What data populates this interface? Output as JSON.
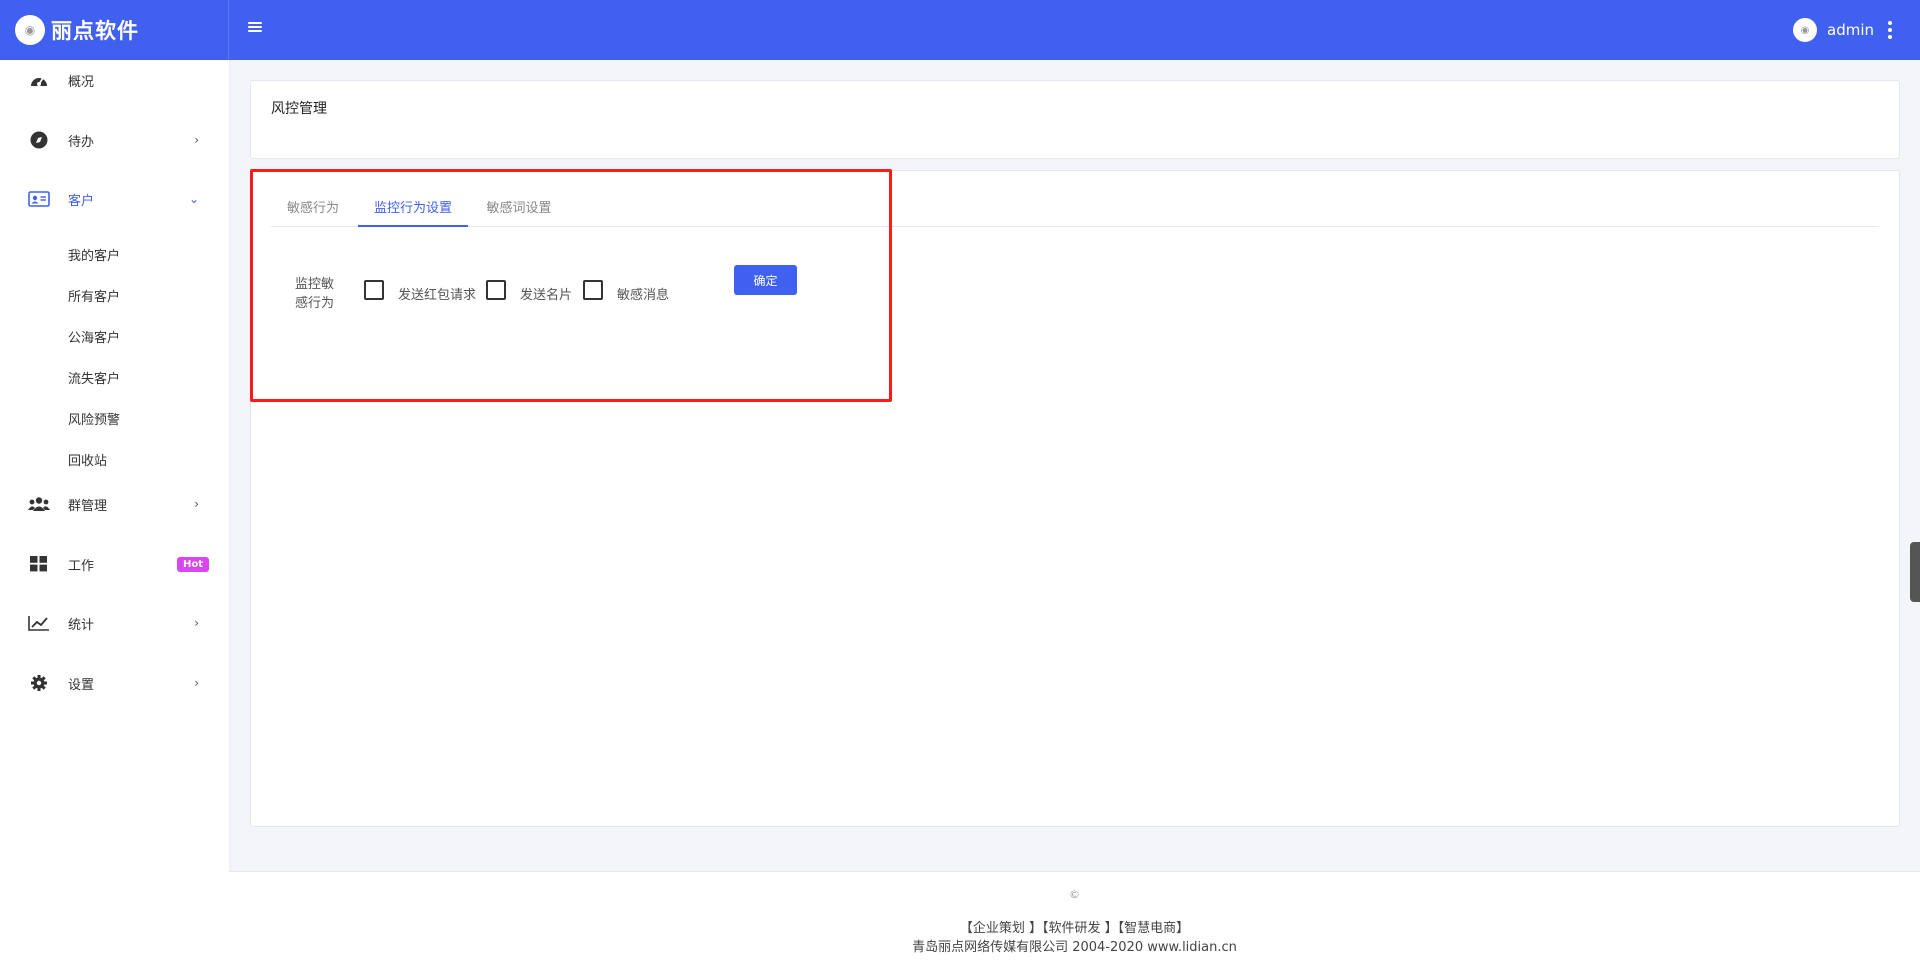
{
  "brand": {
    "name": "丽点软件"
  },
  "user": {
    "name": "admin"
  },
  "sidebar": {
    "items": [
      {
        "label": "概况"
      },
      {
        "label": "待办"
      },
      {
        "label": "客户"
      },
      {
        "label": "群管理"
      },
      {
        "label": "工作",
        "badge": "Hot"
      },
      {
        "label": "统计"
      },
      {
        "label": "设置"
      }
    ],
    "customer_sub": [
      "我的客户",
      "所有客户",
      "公海客户",
      "流失客户",
      "风险预警",
      "回收站"
    ]
  },
  "page": {
    "title": "风控管理"
  },
  "tabs": [
    "敏感行为",
    "监控行为设置",
    "敏感词设置"
  ],
  "form": {
    "label": "监控敏感行为",
    "options": [
      "发送红包请求",
      "发送名片",
      "敏感消息"
    ],
    "confirm": "确定"
  },
  "footer": {
    "copy": "©",
    "links": "【企业策划 】【软件研发 】【智慧电商】",
    "company": "青岛丽点网络传媒有限公司 2004-2020 www.lidian.cn"
  },
  "colors": {
    "primary": "#4060f0",
    "highlight": "#ff1a1a",
    "hot": "#d946ef"
  }
}
